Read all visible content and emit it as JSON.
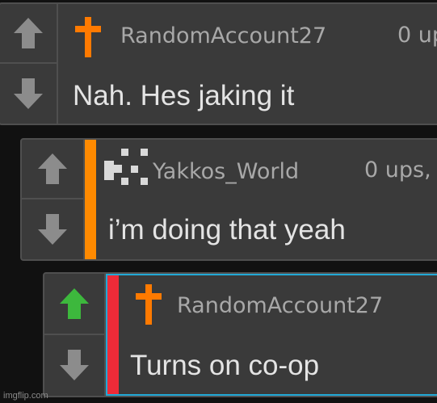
{
  "colors": {
    "background": "#111111",
    "panel": "#3a3a3a",
    "border": "#4f4f4f",
    "username": "#a8a8a8",
    "text": "#e4e4e4",
    "arrow_default": "#8c8c8c",
    "arrow_upvoted": "#3db83d",
    "stripe_orange": "#ff8a00",
    "stripe_red": "#ee2b38",
    "highlight_border": "#22a9d6",
    "cross_icon": "#ff7a00"
  },
  "comments": [
    {
      "username": "RandomAccount27",
      "points": "0 up",
      "text": "Nah. Hes jaking it",
      "avatar_icon": "orange-cross-icon",
      "upvoted": false
    },
    {
      "username": "Yakkos_World",
      "points": "0 ups,",
      "text": "i’m doing that yeah",
      "avatar_icon": "pixel-identicon-icon",
      "upvoted": false
    },
    {
      "username": "RandomAccount27",
      "points": "",
      "text": "Turns on co-op",
      "avatar_icon": "orange-cross-icon",
      "upvoted": true
    }
  ],
  "watermark": "imgflip.com"
}
